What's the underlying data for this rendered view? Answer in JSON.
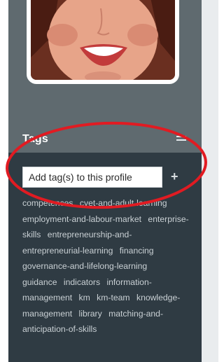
{
  "profile": {
    "photo_alt": "profile-photo"
  },
  "tags_panel": {
    "title": "Tags",
    "input_placeholder": "Add tag(s) to this profile",
    "add_symbol": "+",
    "tags": [
      "competences",
      "cvet-and-adult-learning",
      "employment-and-labour-market",
      "enterprise-skills",
      "entrepreneurship-and-entrepreneurial-learning",
      "financing",
      "governance-and-lifelong-learning",
      "guidance",
      "indicators",
      "information-management",
      "km",
      "km-team",
      "knowledge-management",
      "library",
      "matching-and-anticipation-of-skills"
    ]
  },
  "colors": {
    "sidebar_dark": "#2f3b43",
    "sidebar_mid": "#5f6a6f",
    "annotation_red": "#e11b22"
  },
  "icons": {
    "menu": "menu-icon",
    "add": "plus-icon"
  }
}
